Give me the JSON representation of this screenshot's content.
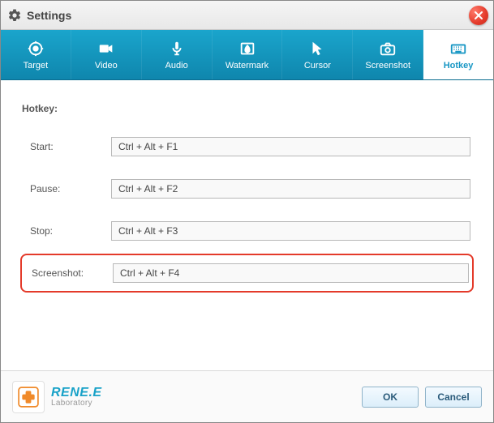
{
  "window": {
    "title": "Settings"
  },
  "tabs": {
    "target": "Target",
    "video": "Video",
    "audio": "Audio",
    "watermark": "Watermark",
    "cursor": "Cursor",
    "screenshot": "Screenshot",
    "hotkey": "Hotkey"
  },
  "section": {
    "heading": "Hotkey:"
  },
  "fields": {
    "start": {
      "label": "Start:",
      "value": "Ctrl + Alt + F1"
    },
    "pause": {
      "label": "Pause:",
      "value": "Ctrl + Alt + F2"
    },
    "stop": {
      "label": "Stop:",
      "value": "Ctrl + Alt + F3"
    },
    "screenshot": {
      "label": "Screenshot:",
      "value": "Ctrl + Alt + F4"
    }
  },
  "footer": {
    "brand": "RENE.E",
    "sub": "Laboratory",
    "ok": "OK",
    "cancel": "Cancel"
  }
}
